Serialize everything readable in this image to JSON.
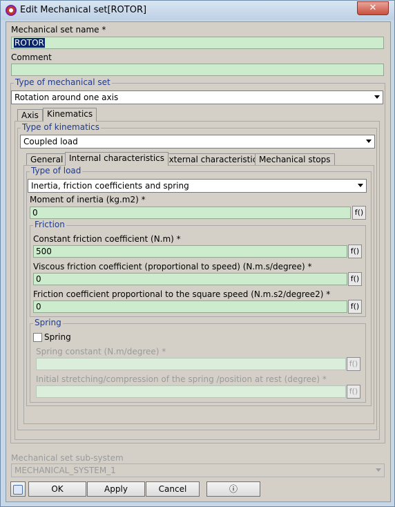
{
  "window": {
    "title": "Edit Mechanical set[ROTOR]",
    "close": "✕"
  },
  "name": {
    "label": "Mechanical set name *",
    "value": "ROTOR"
  },
  "comment": {
    "label": "Comment",
    "value": ""
  },
  "type_group": {
    "title": "Type of mechanical set",
    "selected": "Rotation around one axis"
  },
  "outer_tabs": {
    "axis": "Axis",
    "kinematics": "Kinematics"
  },
  "kinematics": {
    "title": "Type of kinematics",
    "selected": "Coupled load"
  },
  "inner_tabs": {
    "general": "General",
    "internal": "Internal characteristics",
    "external": "External characteristics",
    "stops": "Mechanical stops"
  },
  "load": {
    "title": "Type of load",
    "selected": "Inertia, friction coefficients and spring"
  },
  "inertia": {
    "label": "Moment of inertia (kg.m2) *",
    "value": "0",
    "fx": "f()"
  },
  "friction": {
    "title": "Friction",
    "constant": {
      "label": "Constant friction coefficient (N.m) *",
      "value": "500",
      "fx": "f()"
    },
    "viscous": {
      "label": "Viscous friction coefficient (proportional to speed) (N.m.s/degree) *",
      "value": "0",
      "fx": "f()"
    },
    "square": {
      "label": "Friction coefficient proportional to the square speed (N.m.s2/degree2) *",
      "value": "0",
      "fx": "f()"
    }
  },
  "spring": {
    "title": "Spring",
    "checkbox_label": "Spring",
    "checked": false,
    "constant": {
      "label": "Spring constant (N.m/degree) *",
      "value": "",
      "fx": "f()"
    },
    "stretch": {
      "label": "Initial stretching/compression of the spring /position at rest (degree) *",
      "value": "",
      "fx": "f()"
    }
  },
  "subsystem": {
    "label": "Mechanical set sub-system",
    "selected": "MECHANICAL_SYSTEM_1"
  },
  "buttons": {
    "ok": "OK",
    "apply": "Apply",
    "cancel": "Cancel",
    "info": "ⓘ"
  },
  "icons": {
    "app": "app-logo-icon",
    "help": "help-icon"
  }
}
